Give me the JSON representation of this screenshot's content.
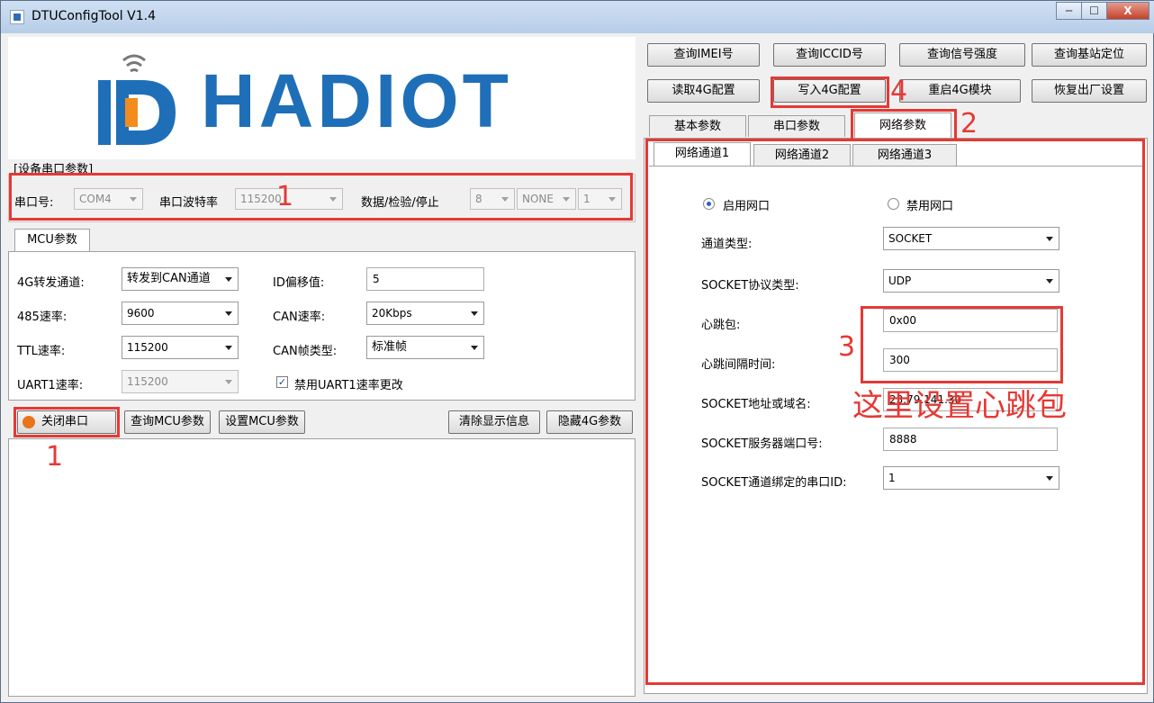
{
  "window": {
    "title": "DTUConfigTool V1.4",
    "min": "─",
    "max": "☐",
    "close": "X"
  },
  "logo": {
    "text": "HADIOT"
  },
  "serial": {
    "group_label": "[设备串口参数]",
    "port_label": "串口号:",
    "port_value": "COM4",
    "baud_label": "串口波特率",
    "baud_value": "115200",
    "dps_label": "数据/检验/停止",
    "data_bits": "8",
    "parity": "NONE",
    "stop_bits": "1"
  },
  "mcu": {
    "tab_label": "MCU参数",
    "fwd_label": "4G转发通道:",
    "fwd_value": "转发到CAN通道",
    "id_offset_label": "ID偏移值:",
    "id_offset_value": "5",
    "rate485_label": "485速率:",
    "rate485_value": "9600",
    "can_rate_label": "CAN速率:",
    "can_rate_value": "20Kbps",
    "ttl_label": "TTL速率:",
    "ttl_value": "115200",
    "can_frame_label": "CAN帧类型:",
    "can_frame_value": "标准帧",
    "uart1_label": "UART1速率:",
    "uart1_value": "115200",
    "disable_uart1_label": "禁用UART1速率更改"
  },
  "bottom_buttons": {
    "close_port": "关闭串口",
    "query_mcu": "查询MCU参数",
    "set_mcu": "设置MCU参数",
    "clear_log": "清除显示信息",
    "hide_4g": "隐藏4G参数"
  },
  "top_buttons": {
    "query_imei": "查询IMEI号",
    "query_iccid": "查询ICCID号",
    "query_signal": "查询信号强度",
    "query_location": "查询基站定位",
    "read_4g": "读取4G配置",
    "write_4g": "写入4G配置",
    "restart_4g": "重启4G模块",
    "factory_reset": "恢复出厂设置"
  },
  "param_tabs": [
    "基本参数",
    "串口参数",
    "网络参数"
  ],
  "channel_tabs": [
    "网络通道1",
    "网络通道2",
    "网络通道3"
  ],
  "network": {
    "enable_label": "启用网口",
    "disable_label": "禁用网口",
    "channel_type_label": "通道类型:",
    "channel_type_value": "SOCKET",
    "protocol_label": "SOCKET协议类型:",
    "protocol_value": "UDP",
    "heartbeat_label": "心跳包:",
    "heartbeat_value": "0x00",
    "interval_label": "心跳间隔时间:",
    "interval_value": "300",
    "address_label": "SOCKET地址或域名:",
    "address_value": "23.79.141.30",
    "port_label": "SOCKET服务器端口号:",
    "port_value": "8888",
    "bind_label": "SOCKET通道绑定的串口ID:",
    "bind_value": "1"
  },
  "annotations": {
    "n1a": "1",
    "n1b": "1",
    "n2": "2",
    "n3": "3",
    "n4": "4",
    "note": "这里设置心跳包",
    "color": "#e53935"
  }
}
